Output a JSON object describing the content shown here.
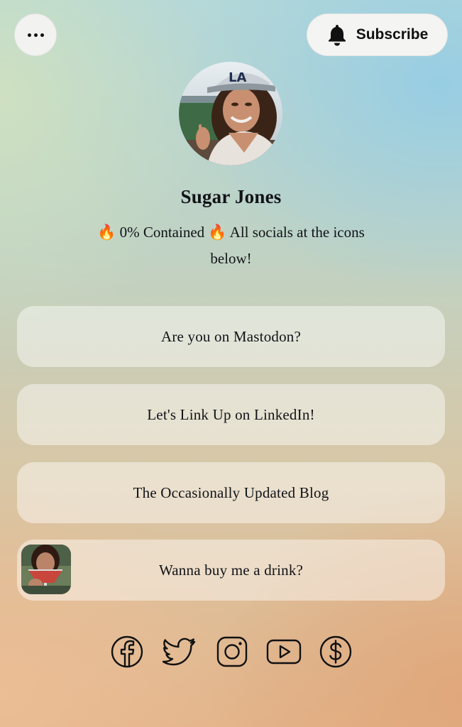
{
  "header": {
    "more_icon": "ellipsis-icon",
    "subscribe_icon": "bell-icon",
    "subscribe_label": "Subscribe"
  },
  "profile": {
    "name": "Sugar Jones",
    "bio_emoji": "🔥",
    "bio_text_1": "0% Contained",
    "bio_text_2": "All socials at the icons",
    "bio_text_3": "below!"
  },
  "links": [
    {
      "label": "Are you on Mastodon?"
    },
    {
      "label": "Let's Link Up on LinkedIn!"
    },
    {
      "label": "The Occasionally Updated Blog"
    },
    {
      "label": "Wanna buy me a drink?",
      "has_thumbnail": true
    }
  ],
  "socials": [
    {
      "icon": "facebook-icon"
    },
    {
      "icon": "twitter-icon"
    },
    {
      "icon": "instagram-icon"
    },
    {
      "icon": "youtube-icon"
    },
    {
      "icon": "dollar-icon"
    }
  ],
  "colors": {
    "text": "#111318",
    "card": "rgba(255,255,255,0.45)",
    "button": "#f4f4f2"
  }
}
